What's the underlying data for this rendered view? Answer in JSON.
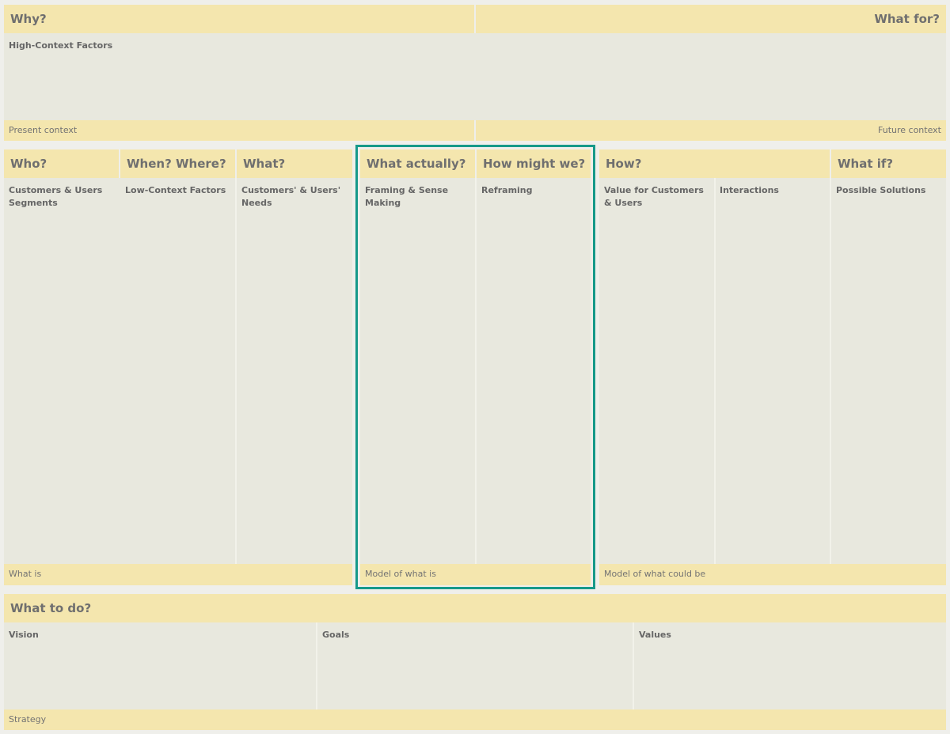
{
  "top": {
    "left_title": "Why?",
    "right_title": "What for?",
    "body_label": "High-Context Factors",
    "left_footer": "Present context",
    "right_footer": "Future context"
  },
  "middle": {
    "columns": [
      {
        "title": "Who?",
        "label": "Customers & Users Segments"
      },
      {
        "title": "When? Where?",
        "label": "Low-Context Factors"
      },
      {
        "title": "What?",
        "label": "Customers' & Users' Needs"
      },
      {
        "title": "What actually?",
        "label": "Framing & Sense Making"
      },
      {
        "title": "How might we?",
        "label": "Reframing"
      },
      {
        "title": "How?",
        "label": "Value for Customers & Users"
      },
      {
        "title": "",
        "label": "Interactions"
      },
      {
        "title": "What if?",
        "label": "Possible Solutions"
      }
    ],
    "footers": [
      "What is",
      "Model of what is",
      "Model of what could be"
    ]
  },
  "bottom": {
    "title": "What to do?",
    "labels": [
      "Vision",
      "Goals",
      "Values"
    ],
    "footer": "Strategy"
  },
  "colors": {
    "header": "#f4e6ae",
    "body": "#e8e8de",
    "highlight": "#16998a"
  }
}
